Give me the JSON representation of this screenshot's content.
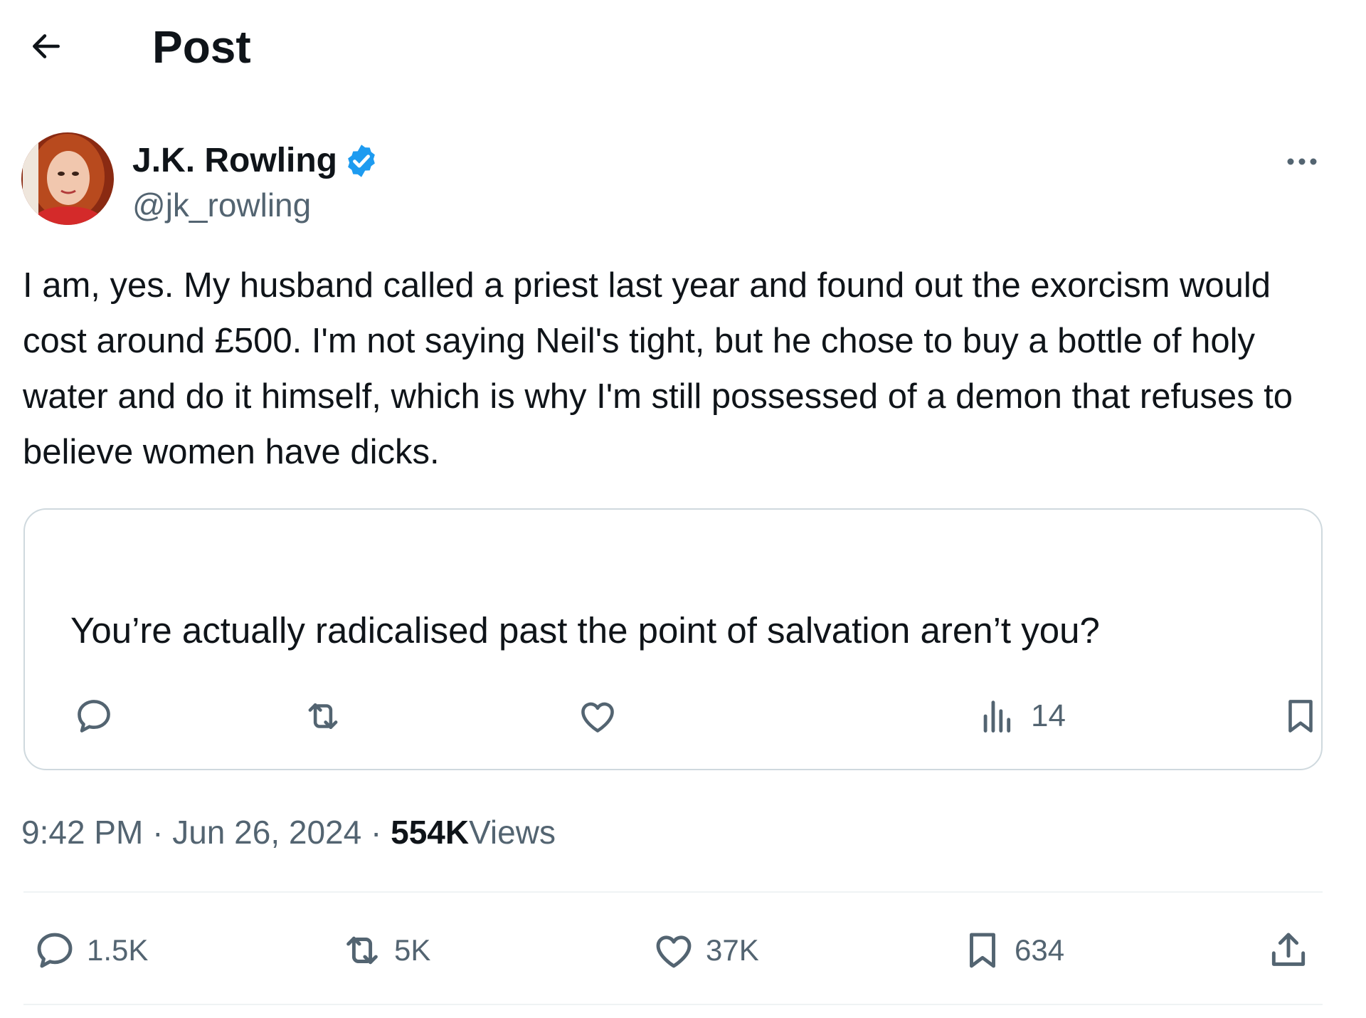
{
  "header": {
    "title": "Post"
  },
  "author": {
    "name": "J.K. Rowling",
    "handle": "@jk_rowling",
    "verified_color": "#1d9bf0"
  },
  "post": {
    "text": "I am, yes. My husband called a priest last year and found out the exorcism would cost around £500. I'm not saying Neil's tight, but he chose to buy a bottle of holy water and do it himself, which is why I'm still possessed of a demon that refuses to believe women have dicks."
  },
  "quote": {
    "text": "You’re actually radicalised past the point of salvation aren’t you?",
    "views": "14"
  },
  "meta": {
    "time": "9:42 PM",
    "date": "Jun 26, 2024",
    "views_count": "554K",
    "views_label": "Views",
    "separator": " · "
  },
  "actions": {
    "replies": "1.5K",
    "reposts": "5K",
    "likes": "37K",
    "bookmarks": "634"
  },
  "icons": [
    "back-arrow-icon",
    "verified-badge-icon",
    "more-icon",
    "reply-icon",
    "repost-icon",
    "like-icon",
    "views-icon",
    "bookmark-icon",
    "share-icon"
  ]
}
